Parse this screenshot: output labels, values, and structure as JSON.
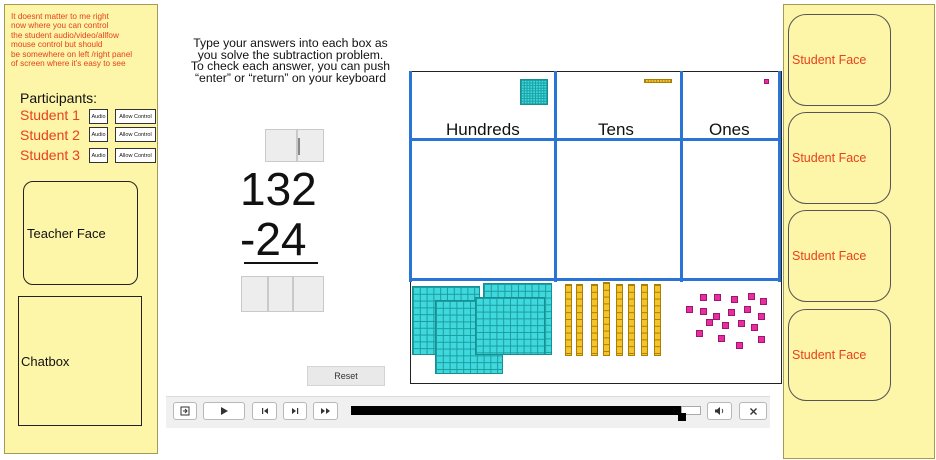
{
  "left_panel": {
    "note_lines": [
      "It doesnt matter to me right",
      "now where you can control",
      "the student audio/video/allfow",
      "mouse control but should",
      "be somewhere on  left /right panel",
      "of screen where it’s easy to see"
    ],
    "participants_title": "Participants:",
    "students": [
      {
        "name": "Student 1",
        "audio": "Audio",
        "control": "Allow Control"
      },
      {
        "name": "Student 2",
        "audio": "Audio",
        "control": "Allow Control"
      },
      {
        "name": "Student 3",
        "audio": "Audio",
        "control": "Allow Control"
      }
    ],
    "teacher_face": "Teacher Face",
    "chatbox": "Chatbox"
  },
  "instructions": [
    "Type your answers into each box as",
    "you solve the subtraction problem.",
    "To check each answer, you can push",
    "“enter” or “return” on your keyboard"
  ],
  "problem": {
    "minuend": "132",
    "subtrahend": "-24"
  },
  "board": {
    "columns": [
      "Hundreds",
      "Tens",
      "Ones"
    ]
  },
  "reset_label": "Reset",
  "player": {
    "progress": 0.99
  },
  "right_panel": {
    "faces": [
      "Student Face",
      "Student Face",
      "Student Face",
      "Student Face"
    ]
  },
  "colors": {
    "panel_bg": "#fdf5a8",
    "accent_text": "#e8411c",
    "board_line": "#2a74d6",
    "hundreds_block": "#3fd8dc",
    "tens_block": "#f4c42a",
    "ones_block": "#e62ea0"
  }
}
